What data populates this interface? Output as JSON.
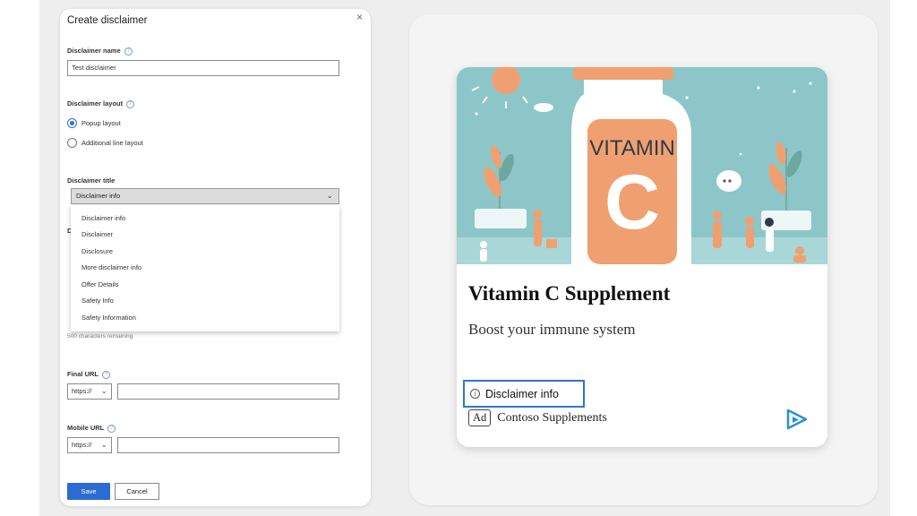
{
  "dialog": {
    "title": "Create disclaimer",
    "close_glyph": "×",
    "help_glyph": "?",
    "name_label": "Disclaimer name",
    "name_value": "Test disclaimer",
    "layout_label": "Disclaimer layout",
    "layout_options": [
      "Popup layout",
      "Additional line layout"
    ],
    "layout_selected": "Popup layout",
    "title_label": "Disclaimer title",
    "title_selected": "Disclaimer info",
    "title_options": [
      "Disclaimer info",
      "Disclaimer",
      "Disclosure",
      "More disclaimer info",
      "Offer Details",
      "Safety Info",
      "Safety Information"
    ],
    "obscured_label_char": "D",
    "chars_remaining": "500 characters remaining",
    "final_url_label": "Final URL",
    "mobile_url_label": "Mobile URL",
    "protocol": "https://",
    "save_label": "Save",
    "cancel_label": "Cancel"
  },
  "preview": {
    "ad_title": "Vitamin C Supplement",
    "ad_description": "Boost your immune system",
    "disclaimer_link": "Disclaimer info",
    "info_glyph": "i",
    "ad_badge": "Ad",
    "advertiser": "Contoso Supplements",
    "bottle_text_1": "VITAMIN",
    "bottle_text_2": "C",
    "icon": "play-arrow-icon",
    "colors": {
      "teal": "#8cc6c8",
      "orange": "#f0a070",
      "highlight": "#2a78d0",
      "save": "#2b6cd2"
    }
  }
}
